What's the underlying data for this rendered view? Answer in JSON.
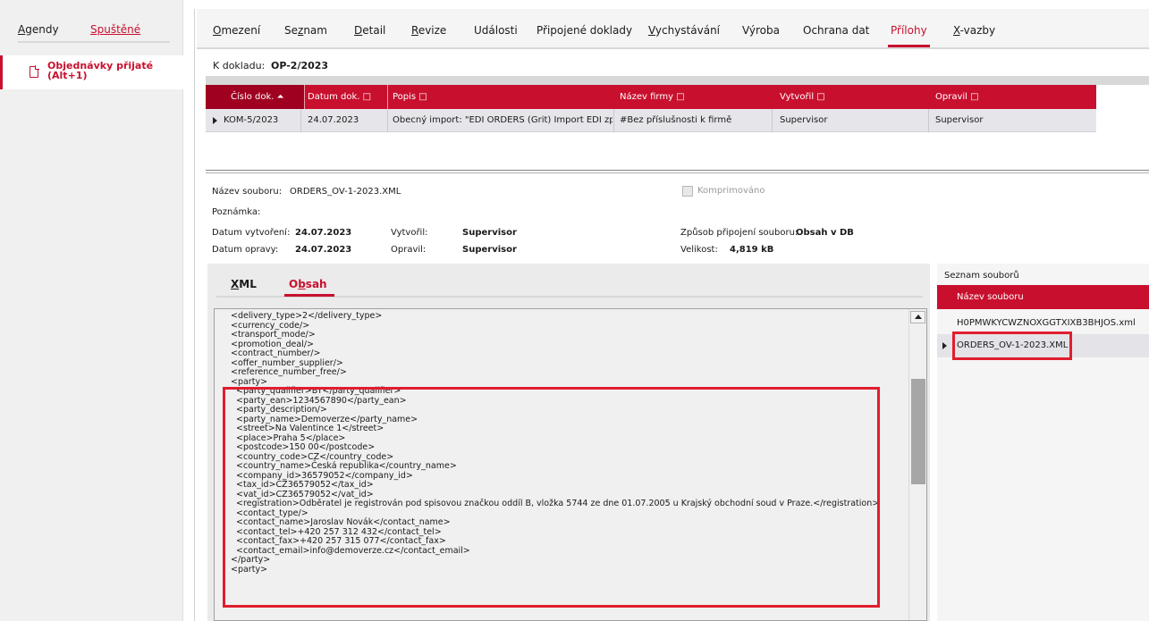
{
  "sidebar": {
    "tabs": [
      {
        "label": "Agendy",
        "accel": "A",
        "rest": "gendy",
        "active": false
      },
      {
        "label": "Spuštěné",
        "active": true
      }
    ],
    "item": {
      "label": "Objednávky přijaté\n(Alt+1)"
    }
  },
  "top_tabs": [
    {
      "label": "Omezení",
      "accel": "O",
      "rest": "mezení"
    },
    {
      "label": "Seznam",
      "pre": "Se",
      "accel": "z",
      "rest": "nam"
    },
    {
      "label": "Detail",
      "accel": "D",
      "rest": "etail"
    },
    {
      "label": "Revize",
      "accel": "R",
      "rest": "evize"
    },
    {
      "label": "Události"
    },
    {
      "label": "Připojené doklady"
    },
    {
      "label": "Vychystávání",
      "accel": "V",
      "rest": "ychystávání"
    },
    {
      "label": "Výroba"
    },
    {
      "label": "Ochrana dat"
    },
    {
      "label": "Přílohy",
      "active": true
    },
    {
      "label": "X-vazby",
      "accel": "X",
      "rest": "-vazby"
    }
  ],
  "doc": {
    "label": "K dokladu:",
    "value": "OP-2/2023"
  },
  "grid": {
    "columns": [
      "Číslo dok. ⏶",
      "Datum dok. □",
      "Popis □",
      "Název firmy □",
      "Vytvořil □",
      "Opravil □"
    ],
    "rows": [
      [
        "KOM-5/2023",
        "24.07.2023",
        "Obecný import: \"EDI ORDERS (Grit) Import EDI zp",
        "#Bez příslušnosti k firmě",
        "Supervisor",
        "Supervisor"
      ]
    ]
  },
  "details": {
    "filename_label": "Název souboru:",
    "filename": "ORDERS_OV-1-2023.XML",
    "compressed_label": "Komprimováno",
    "note_label": "Poznámka:",
    "created_label": "Datum vytvoření:",
    "created": "24.07.2023",
    "creator_label": "Vytvořil:",
    "creator": "Supervisor",
    "attach_label": "Způsob připojení souboru:",
    "attach": "Obsah v DB",
    "modified_label": "Datum opravy:",
    "modified": "24.07.2023",
    "modifier_label": "Opravil:",
    "modifier": "Supervisor",
    "size_label": "Velikost:",
    "size": "4,819 kB"
  },
  "content_tabs": [
    {
      "label": "XML",
      "accel": "X",
      "rest": "ML"
    },
    {
      "label": "Obsah",
      "pre": "O",
      "accel": "b",
      "rest": "sah",
      "active": true
    }
  ],
  "xml_lines": [
    "<delivery_type>2</delivery_type>",
    "<currency_code/>",
    "<transport_mode/>",
    "<promotion_deal/>",
    "<contract_number/>",
    "<offer_number_supplier/>",
    "<reference_number_free/>",
    "<party>",
    "  <party_qualifier>BY</party_qualifier>",
    "  <party_ean>1234567890</party_ean>",
    "  <party_description/>",
    "  <party_name>Demoverze</party_name>",
    "  <street>Na Valentince 1</street>",
    "  <place>Praha 5</place>",
    "  <postcode>150 00</postcode>",
    "  <country_code>CZ</country_code>",
    "  <country_name>Česká republika</country_name>",
    "  <company_id>36579052</company_id>",
    "  <tax_id>CZ36579052</tax_id>",
    "  <vat_id>CZ36579052</vat_id>",
    "  <registration>Odběratel je registrován pod spisovou značkou oddíl B, vložka 5744 ze dne 01.07.2005 u Krajský obchodní soud v Praze.</registration>",
    "  <contact_type/>",
    "  <contact_name>Jaroslav Novák</contact_name>",
    "  <contact_tel>+420 257 312 432</contact_tel>",
    "  <contact_fax>+420 257 315 077</contact_fax>",
    "  <contact_email>info@demoverze.cz</contact_email>",
    "</party>",
    "<party>"
  ],
  "files": {
    "title": "Seznam souborů",
    "header": "Název souboru",
    "rows": [
      {
        "name": "H0PMWKYCWZNOXGGTXIXB3BHJOS.xml",
        "selected": false
      },
      {
        "name": "ORDERS_OV-1-2023.XML",
        "selected": true
      }
    ]
  },
  "colors": {
    "accent": "#c8102e",
    "highlight_box": "#e01e2e"
  }
}
